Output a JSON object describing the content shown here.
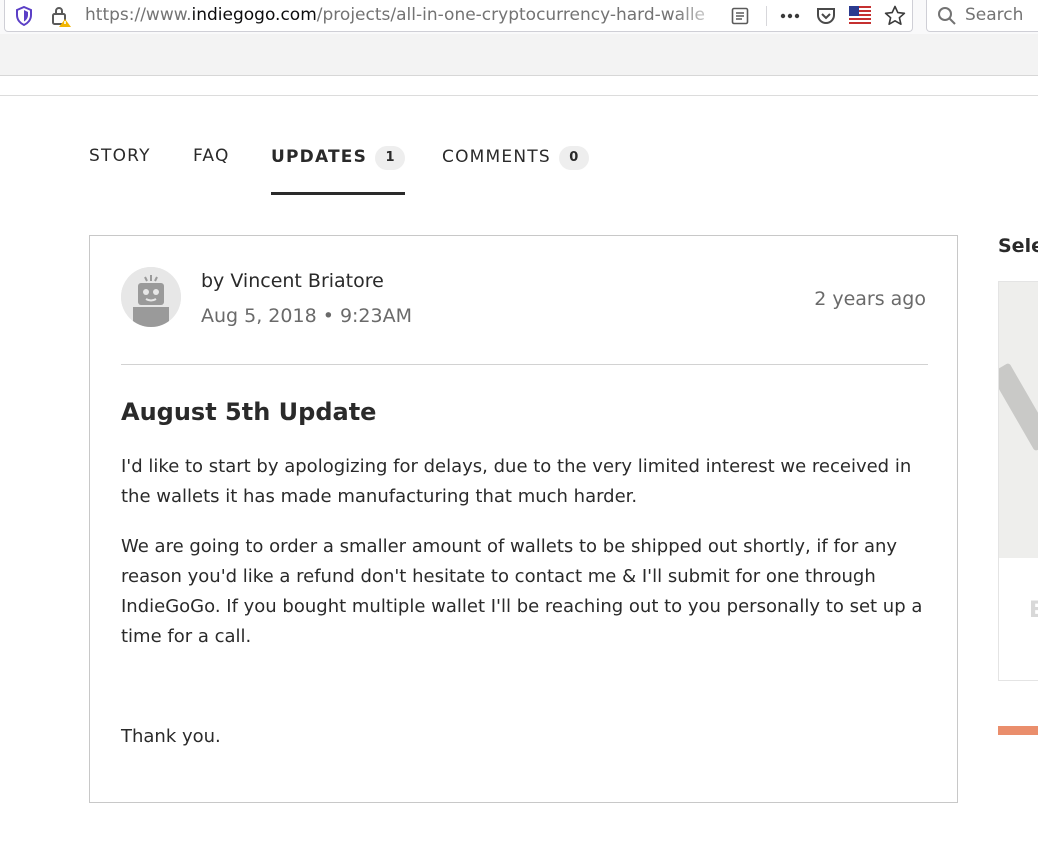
{
  "browser": {
    "url_prefix": "https://www.",
    "url_domain": "indiegogo.com",
    "url_path": "/projects/all-in-one-cryptocurrency-hard-walle",
    "search_placeholder": "Search",
    "icons": [
      "shield-icon",
      "lock-icon",
      "reader-view-icon",
      "more-dots-icon",
      "pocket-icon",
      "us-flag-icon",
      "bookmark-star-icon",
      "search-icon"
    ]
  },
  "tabs": [
    {
      "label": "STORY"
    },
    {
      "label": "FAQ"
    },
    {
      "label": "UPDATES",
      "count": "1",
      "active": true
    },
    {
      "label": "COMMENTS",
      "count": "0"
    }
  ],
  "update": {
    "author": "by Vincent Briatore",
    "date": "Aug 5, 2018 • 9:23AM",
    "relative_time": "2 years ago",
    "title": "August 5th Update",
    "paragraphs": [
      "I'd like to start by apologizing for delays, due to the very limited interest we received in the wallets it has made manufacturing that much harder.",
      "We are going to order a smaller amount of wallets to be shipped out shortly, if for any reason you'd like a refund don't hesitate to contact me & I'll submit for one through IndieGoGo. If you bought multiple wallet I'll be reaching out to you personally to set up a time for a call.",
      "Thank you."
    ]
  },
  "sidebar": {
    "title_partial": "Sele",
    "card_letter_partial": "E"
  },
  "colors": {
    "accent_bar": "#ea8e6c",
    "text": "#2a2a2a",
    "muted": "#6a6a6a"
  }
}
